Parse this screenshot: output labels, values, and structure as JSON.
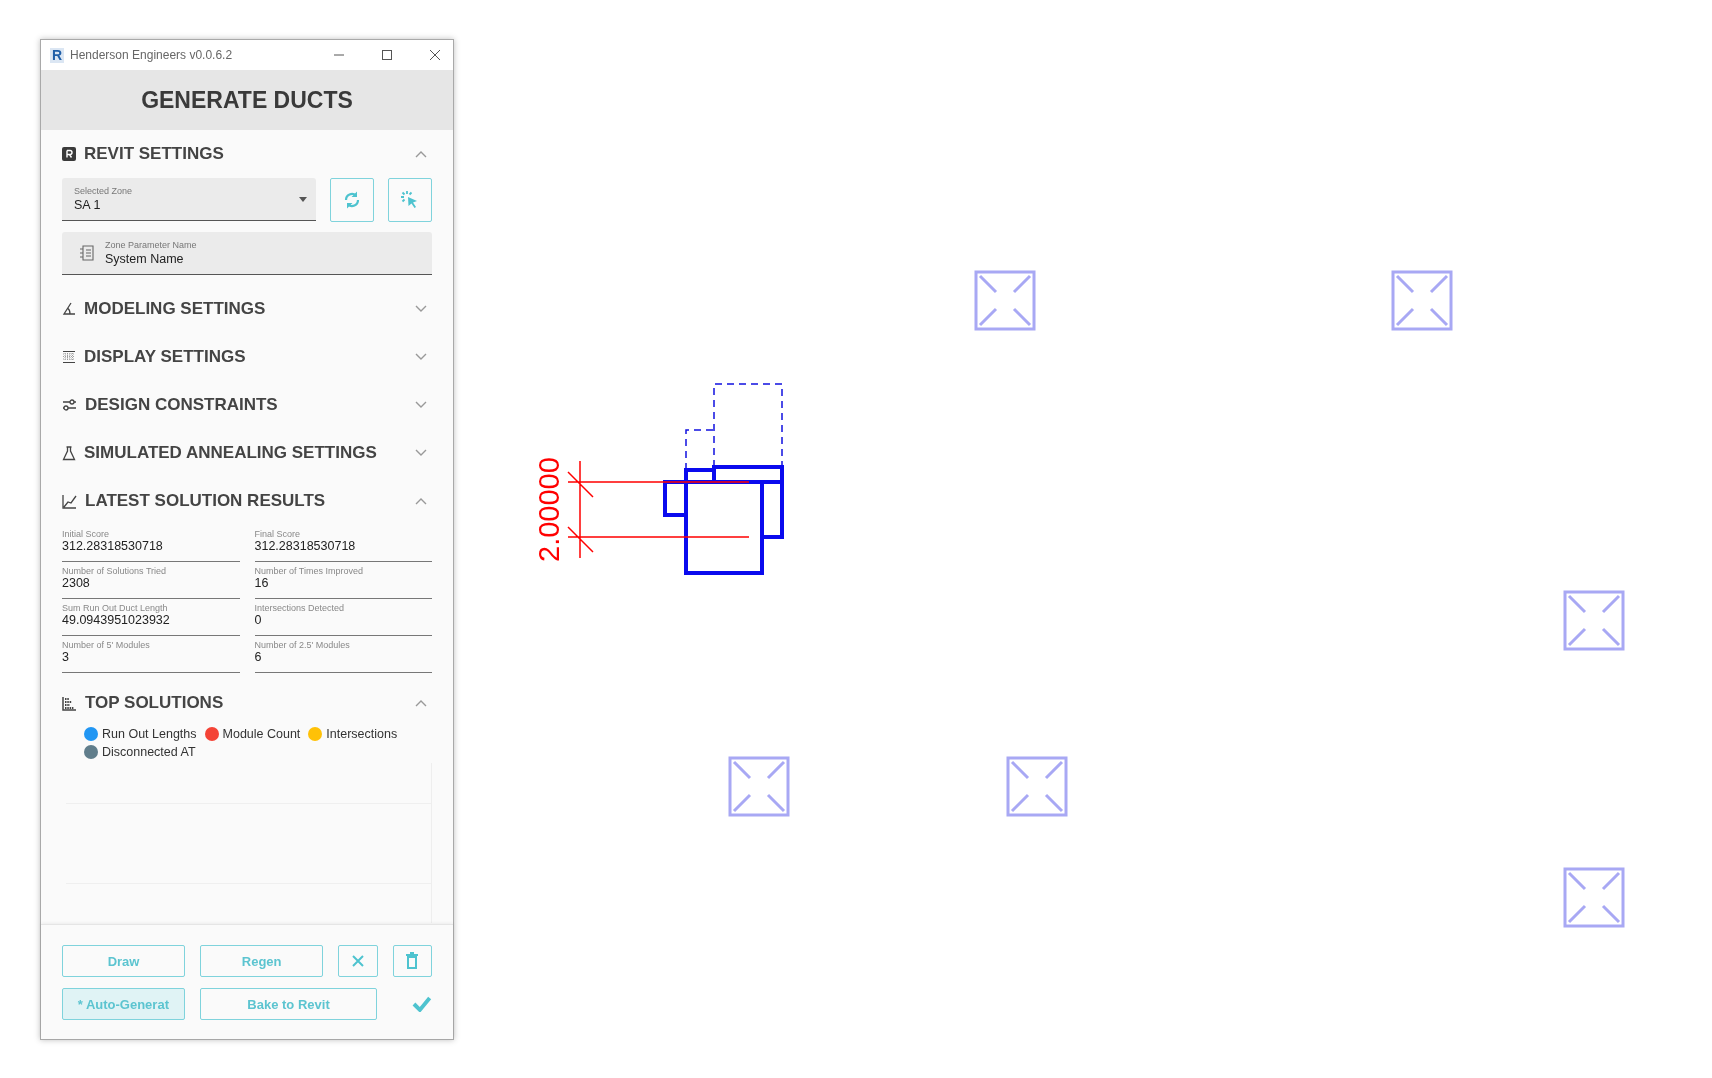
{
  "window": {
    "logo": "R",
    "title": "Henderson Engineers v0.0.6.2"
  },
  "heading": "GENERATE DUCTS",
  "sections": [
    {
      "kind": "zone",
      "title": "REVIT SETTINGS",
      "expanded": true,
      "zone_select": {
        "label": "Selected Zone",
        "value": "SA 1"
      },
      "parameter_field": {
        "label": "Zone Parameter Name",
        "value": "System Name"
      }
    },
    {
      "title": "MODELING SETTINGS",
      "expanded": false
    },
    {
      "title": "DISPLAY SETTINGS",
      "expanded": false
    },
    {
      "title": "DESIGN CONSTRAINTS",
      "expanded": false
    },
    {
      "title": "SIMULATED ANNEALING SETTINGS",
      "expanded": false
    },
    {
      "kind": "results",
      "title": "LATEST SOLUTION RESULTS",
      "expanded": true,
      "fields": [
        {
          "label": "Initial Score",
          "value": "312.28318530718"
        },
        {
          "label": "Final Score",
          "value": "312.28318530718"
        },
        {
          "label": "Number of Solutions Tried",
          "value": "2308"
        },
        {
          "label": "Number of Times Improved",
          "value": "16"
        },
        {
          "label": "Sum Run Out Duct Length",
          "value": "49.0943951023932"
        },
        {
          "label": "Intersections Detected",
          "value": "0"
        },
        {
          "label": "Number of 5' Modules",
          "value": "3"
        },
        {
          "label": "Number of 2.5' Modules",
          "value": "6"
        }
      ]
    },
    {
      "kind": "legend",
      "title": "TOP SOLUTIONS",
      "expanded": true,
      "legend": [
        {
          "label": "Run Out Lengths",
          "color": "#2196f3"
        },
        {
          "label": "Module Count",
          "color": "#f44336"
        },
        {
          "label": "Intersections",
          "color": "#ffc107"
        },
        {
          "label": "Disconnected AT",
          "color": "#607d8b"
        }
      ]
    }
  ],
  "buttons_row_1": [
    {
      "label": "Draw",
      "selected": false
    },
    {
      "label": "Regen",
      "selected": false
    }
  ],
  "buttons_row_2": [
    {
      "label": "* Auto-Generat",
      "selected": true
    },
    {
      "label": "Bake to Revit",
      "selected": false
    }
  ],
  "dimension": {
    "value": "2.00000"
  }
}
